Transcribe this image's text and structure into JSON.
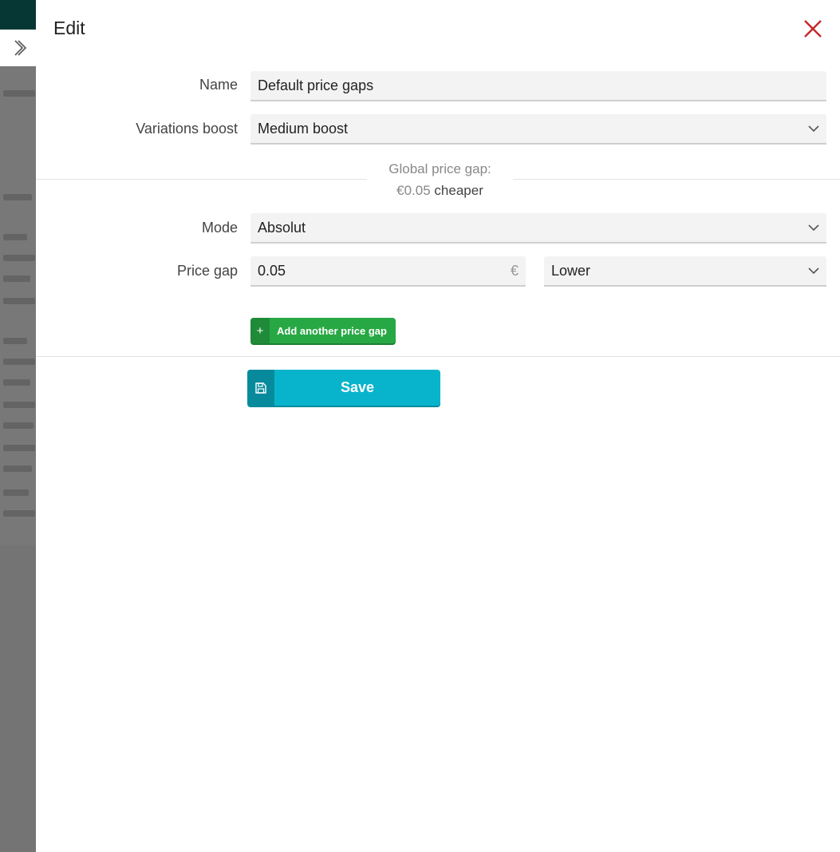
{
  "dialog": {
    "title": "Edit",
    "close_icon": "close-icon"
  },
  "form": {
    "name_label": "Name",
    "name_value": "Default price gaps",
    "variations_boost_label": "Variations boost",
    "variations_boost_value": "Medium boost",
    "global_gap_label": "Global price gap:",
    "global_gap_amount": "€0.05",
    "global_gap_suffix": "cheaper",
    "mode_label": "Mode",
    "mode_value": "Absolut",
    "price_gap_label": "Price gap",
    "price_gap_value": "0.05",
    "price_gap_currency": "€",
    "direction_value": "Lower",
    "add_gap_label": "Add another price gap",
    "save_label": "Save"
  },
  "colors": {
    "accent_close": "#c62828",
    "add_button": "#27a844",
    "save_button": "#08b4cc",
    "topbar": "#0f6e68"
  }
}
